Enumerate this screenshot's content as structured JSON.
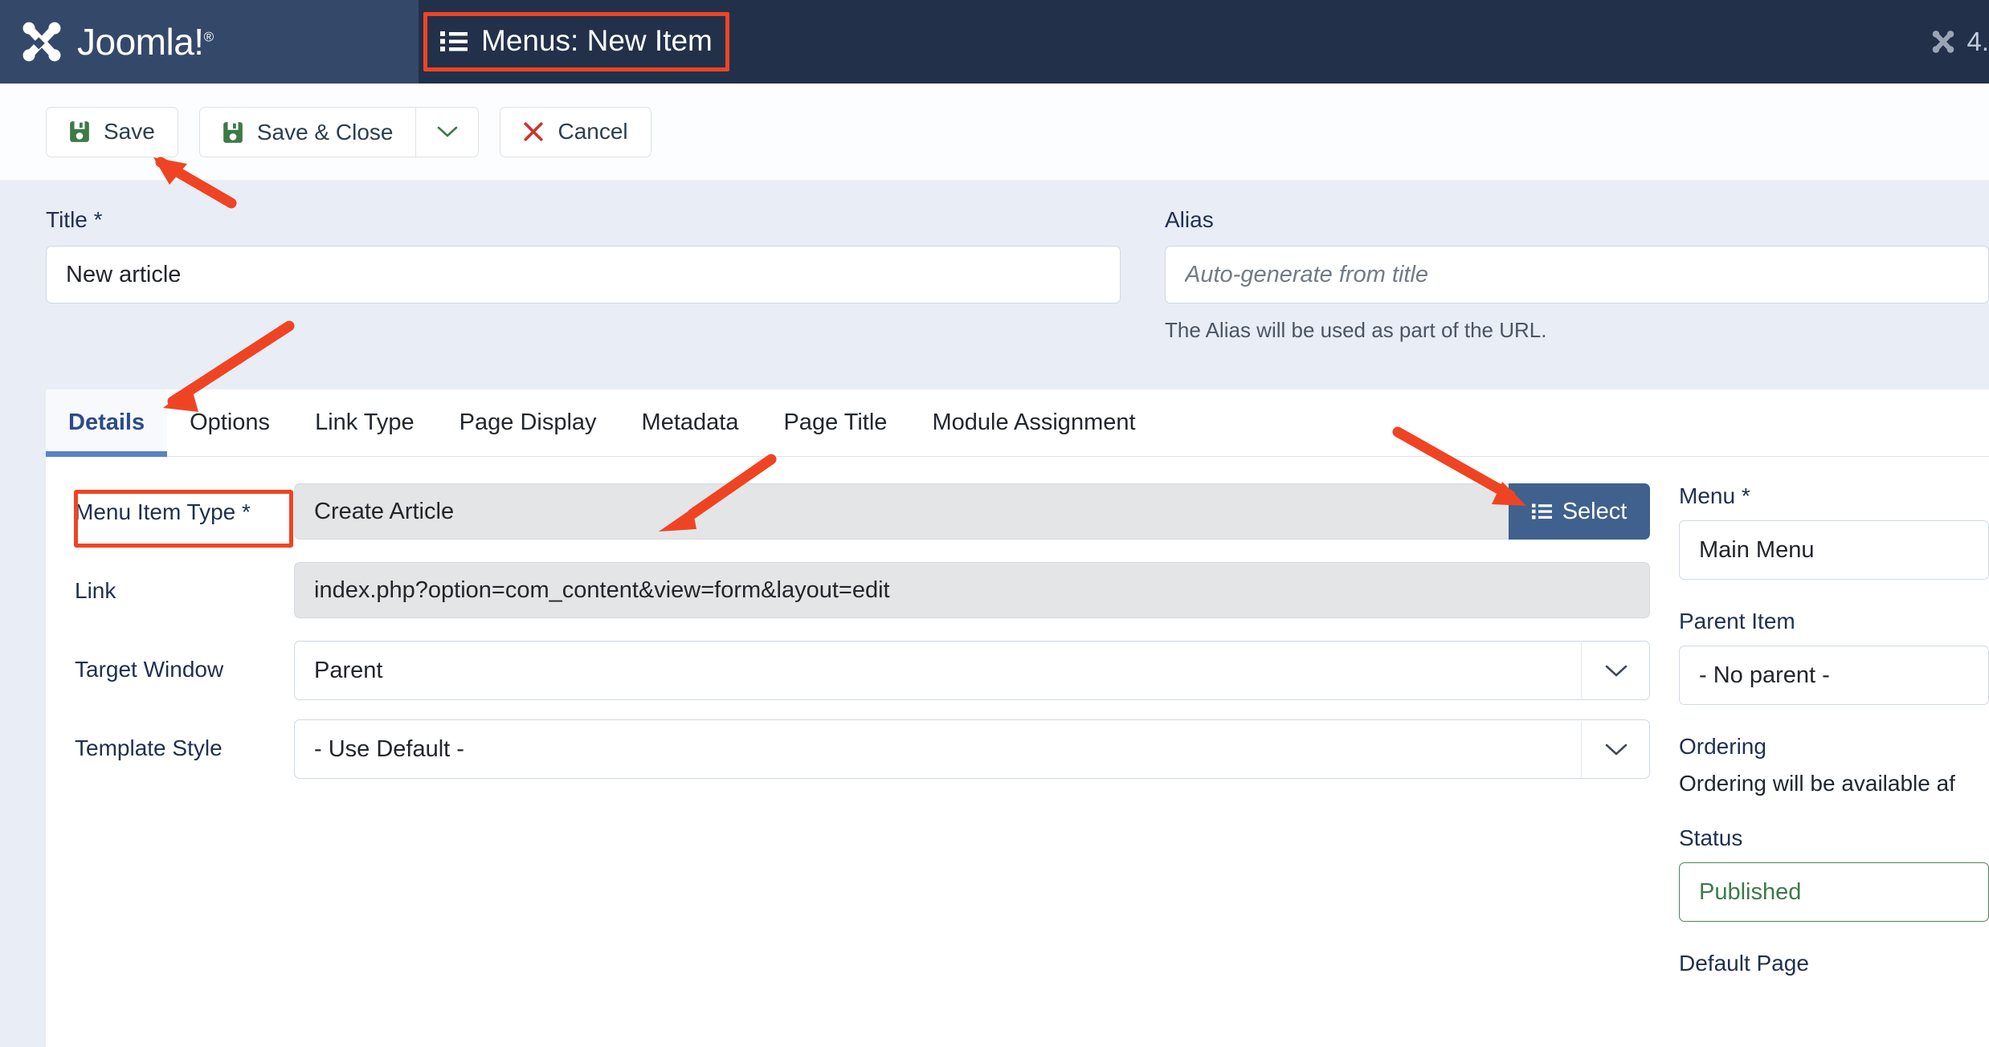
{
  "topbar": {
    "brand_name": "Joomla!",
    "brand_reg": "®",
    "page_title": "Menus: New Item",
    "version_text": "4."
  },
  "toolbar": {
    "save_label": "Save",
    "save_close_label": "Save & Close",
    "cancel_label": "Cancel"
  },
  "fields": {
    "title_label": "Title *",
    "title_value": "New article",
    "alias_label": "Alias",
    "alias_value": "",
    "alias_placeholder": "Auto-generate from title",
    "alias_help": "The Alias will be used as part of the URL."
  },
  "tabs": [
    {
      "label": "Details",
      "active": true
    },
    {
      "label": "Options",
      "active": false
    },
    {
      "label": "Link Type",
      "active": false
    },
    {
      "label": "Page Display",
      "active": false
    },
    {
      "label": "Metadata",
      "active": false
    },
    {
      "label": "Page Title",
      "active": false
    },
    {
      "label": "Module Assignment",
      "active": false
    }
  ],
  "details": {
    "menu_item_type_label": "Menu Item Type *",
    "menu_item_type_value": "Create Article",
    "select_label": "Select",
    "link_label": "Link",
    "link_value": "index.php?option=com_content&view=form&layout=edit",
    "target_window_label": "Target Window",
    "target_window_value": "Parent",
    "template_style_label": "Template Style",
    "template_style_value": "- Use Default -"
  },
  "sidebar": {
    "menu_label": "Menu *",
    "menu_value": "Main Menu",
    "parent_item_label": "Parent Item",
    "parent_item_value": " - No parent -",
    "ordering_label": "Ordering",
    "ordering_note": "Ordering will be available af",
    "status_label": "Status",
    "status_value": "Published",
    "default_page_label": "Default Page"
  },
  "colors": {
    "topbar": "#34496a",
    "title_zone": "#22304a",
    "annotation_red": "#ef4423",
    "accent_blue": "#40618d",
    "tab_underline": "#5b82c4",
    "status_green": "#3d7a4b",
    "content_bg": "#e9edf5"
  }
}
